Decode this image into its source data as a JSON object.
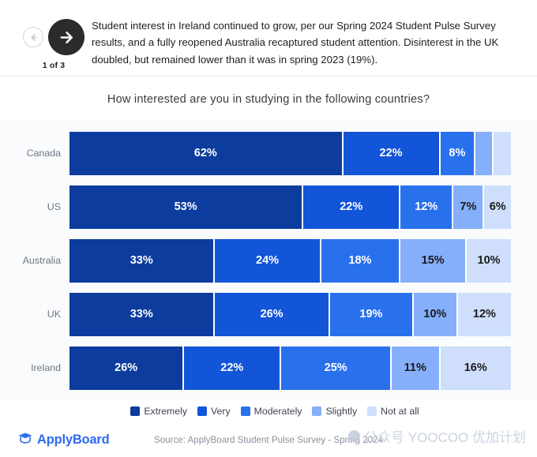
{
  "header": {
    "prev_icon": "arrow-left-icon",
    "next_icon": "arrow-right-icon",
    "counter": "1 of 3",
    "headline": "Student interest in Ireland continued to grow, per our Spring 2024 Student Pulse Survey results, and a fully reopened Australia recaptured student attention. Disinterest in the UK doubled, but remained lower than it was in spring 2023 (19%)."
  },
  "footer": {
    "brand_icon": "graduation-cap-icon",
    "brand_name": "ApplyBoard",
    "source": "Source: ApplyBoard Student Pulse Survey - Spring 2024",
    "watermark": "公众号 YOOCOO 优加计划"
  },
  "chart_data": {
    "type": "bar",
    "orientation": "horizontal",
    "stacked": true,
    "normalized": "percent",
    "title": "How interested are you in studying in the following countries?",
    "xlabel": "",
    "ylabel": "",
    "xlim": [
      0,
      100
    ],
    "grid": false,
    "legend_position": "bottom",
    "categories": [
      "Canada",
      "US",
      "Australia",
      "UK",
      "Ireland"
    ],
    "series": [
      {
        "name": "Extremely",
        "color": "#0B3C9E",
        "values": [
          62,
          53,
          33,
          33,
          26
        ]
      },
      {
        "name": "Very",
        "color": "#1255D8",
        "values": [
          22,
          22,
          24,
          26,
          22
        ]
      },
      {
        "name": "Moderately",
        "color": "#2970ED",
        "values": [
          8,
          12,
          18,
          19,
          25
        ]
      },
      {
        "name": "Slightly",
        "color": "#85AFFA",
        "values": [
          4,
          7,
          15,
          10,
          11
        ]
      },
      {
        "name": "Not at all",
        "color": "#CEDEFB",
        "values": [
          4,
          6,
          10,
          12,
          16
        ]
      }
    ],
    "data_labels": [
      [
        "62%",
        "22%",
        "8%",
        "",
        ""
      ],
      [
        "53%",
        "22%",
        "12%",
        "7%",
        "6%"
      ],
      [
        "33%",
        "24%",
        "18%",
        "15%",
        "10%"
      ],
      [
        "33%",
        "26%",
        "19%",
        "10%",
        "12%"
      ],
      [
        "26%",
        "22%",
        "25%",
        "11%",
        "16%"
      ]
    ],
    "label_text_colors": [
      [
        "light",
        "light",
        "light",
        "dark",
        "dark"
      ],
      [
        "light",
        "light",
        "light",
        "dark",
        "dark"
      ],
      [
        "light",
        "light",
        "light",
        "dark",
        "dark"
      ],
      [
        "light",
        "light",
        "light",
        "dark",
        "dark"
      ],
      [
        "light",
        "light",
        "light",
        "dark",
        "dark"
      ]
    ]
  }
}
